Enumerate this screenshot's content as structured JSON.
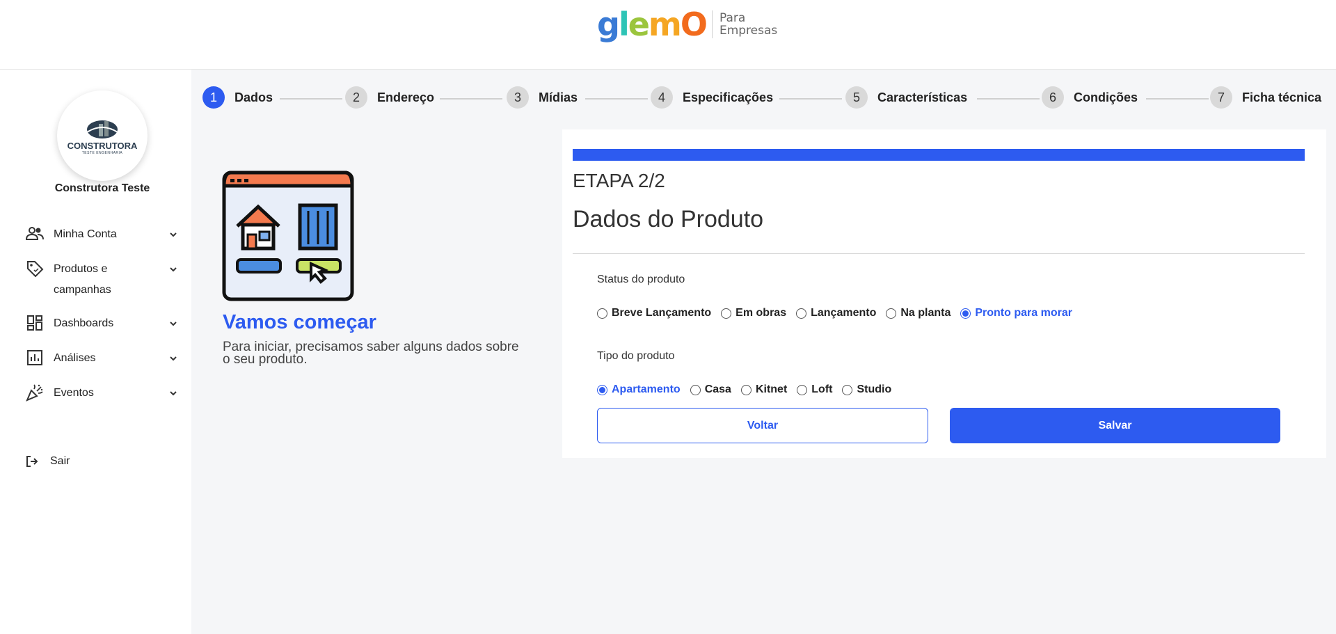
{
  "header": {
    "logo_text": "glemO",
    "logo_sub_1": "Para",
    "logo_sub_2": "Empresas"
  },
  "sidebar": {
    "avatar_text": "CONSTRUTORA",
    "avatar_sub": "TESTE ENGENHARIA",
    "company_name": "Construtora Teste",
    "items": [
      {
        "label": "Minha Conta",
        "icon": "users-icon"
      },
      {
        "label": "Produtos e campanhas",
        "icon": "tag-icon"
      },
      {
        "label": "Dashboards",
        "icon": "dashboard-icon"
      },
      {
        "label": "Análises",
        "icon": "chart-icon"
      },
      {
        "label": "Eventos",
        "icon": "party-icon"
      }
    ],
    "logout_label": "Sair"
  },
  "stepper": {
    "steps": [
      {
        "num": "1",
        "label": "Dados"
      },
      {
        "num": "2",
        "label": "Endereço"
      },
      {
        "num": "3",
        "label": "Mídias"
      },
      {
        "num": "4",
        "label": "Especificações"
      },
      {
        "num": "5",
        "label": "Características"
      },
      {
        "num": "6",
        "label": "Condições"
      },
      {
        "num": "7",
        "label": "Ficha técnica"
      }
    ],
    "active_step": 1
  },
  "intro": {
    "title": "Vamos começar",
    "text": "Para iniciar, precisamos saber alguns dados sobre o seu produto."
  },
  "form": {
    "etapa": "ETAPA 2/2",
    "title": "Dados do Produto",
    "progress": 1.0,
    "status_label": "Status do produto",
    "status_options": [
      "Breve Lançamento",
      "Em obras",
      "Lançamento",
      "Na planta",
      "Pronto para morar"
    ],
    "status_selected": "Pronto para morar",
    "tipo_label": "Tipo do produto",
    "tipo_options": [
      "Apartamento",
      "Casa",
      "Kitnet",
      "Loft",
      "Studio"
    ],
    "tipo_selected": "Apartamento",
    "back_label": "Voltar",
    "save_label": "Salvar"
  },
  "colors": {
    "accent": "#2d5bf0",
    "background": "#f5f6f8"
  }
}
